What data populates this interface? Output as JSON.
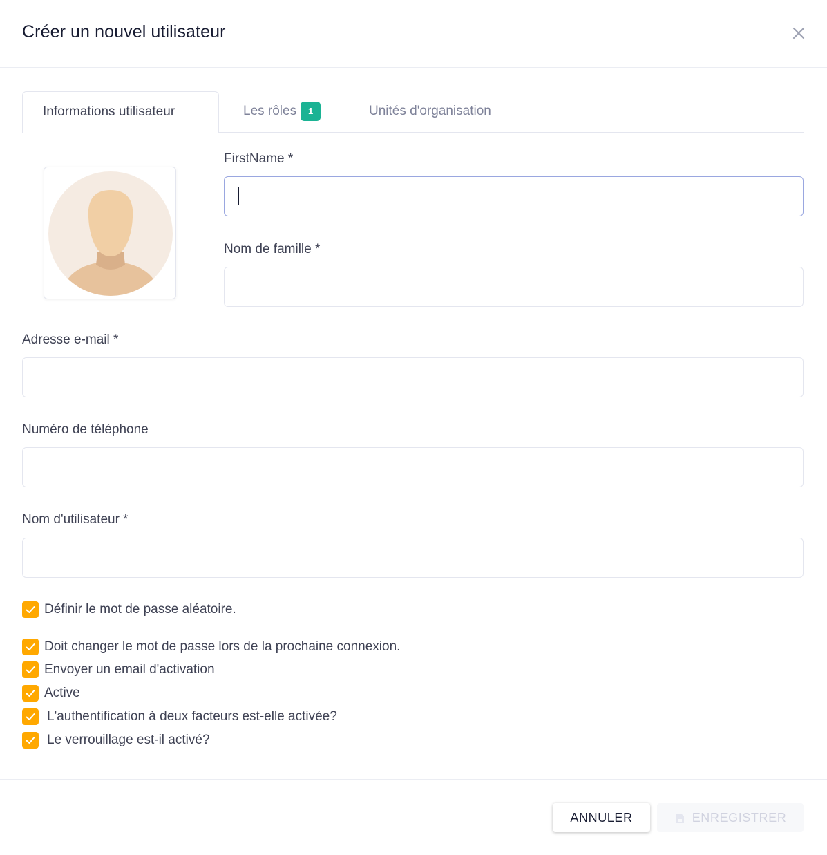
{
  "modal": {
    "title": "Créer un nouvel utilisateur",
    "close_icon": "close-icon"
  },
  "tabs": [
    {
      "label": "Informations utilisateur",
      "active": true
    },
    {
      "label": "Les rôles",
      "badge": "1",
      "badge_color": "#1bb394"
    },
    {
      "label": "Unités d'organisation"
    }
  ],
  "avatar": {
    "icon": "user-avatar-icon"
  },
  "fields": {
    "first_name": {
      "label": "FirstName *",
      "value": "",
      "focused": true
    },
    "last_name": {
      "label": "Nom de famille *",
      "value": ""
    },
    "email": {
      "label": "Adresse e-mail *",
      "value": ""
    },
    "phone": {
      "label": "Numéro de téléphone",
      "value": ""
    },
    "username": {
      "label": "Nom d'utilisateur *",
      "value": ""
    }
  },
  "checkboxes": [
    {
      "label": "Définir le mot de passe aléatoire.",
      "checked": true
    },
    {
      "label": "Doit changer le mot de passe lors de la prochaine connexion.",
      "checked": true
    },
    {
      "label": "Envoyer un email d'activation",
      "checked": true
    },
    {
      "label": "Active",
      "checked": true
    },
    {
      "label": "L'authentification à deux facteurs est-elle activée?",
      "checked": true
    },
    {
      "label": "Le verrouillage est-il activé?",
      "checked": true
    }
  ],
  "footer": {
    "cancel_label": "ANNULER",
    "save_label": "ENREGISTRER",
    "save_icon": "save-icon",
    "save_disabled": true
  },
  "colors": {
    "checkbox": "#ffa800",
    "badge": "#1bb394",
    "focus_border": "#9aa7e0"
  }
}
